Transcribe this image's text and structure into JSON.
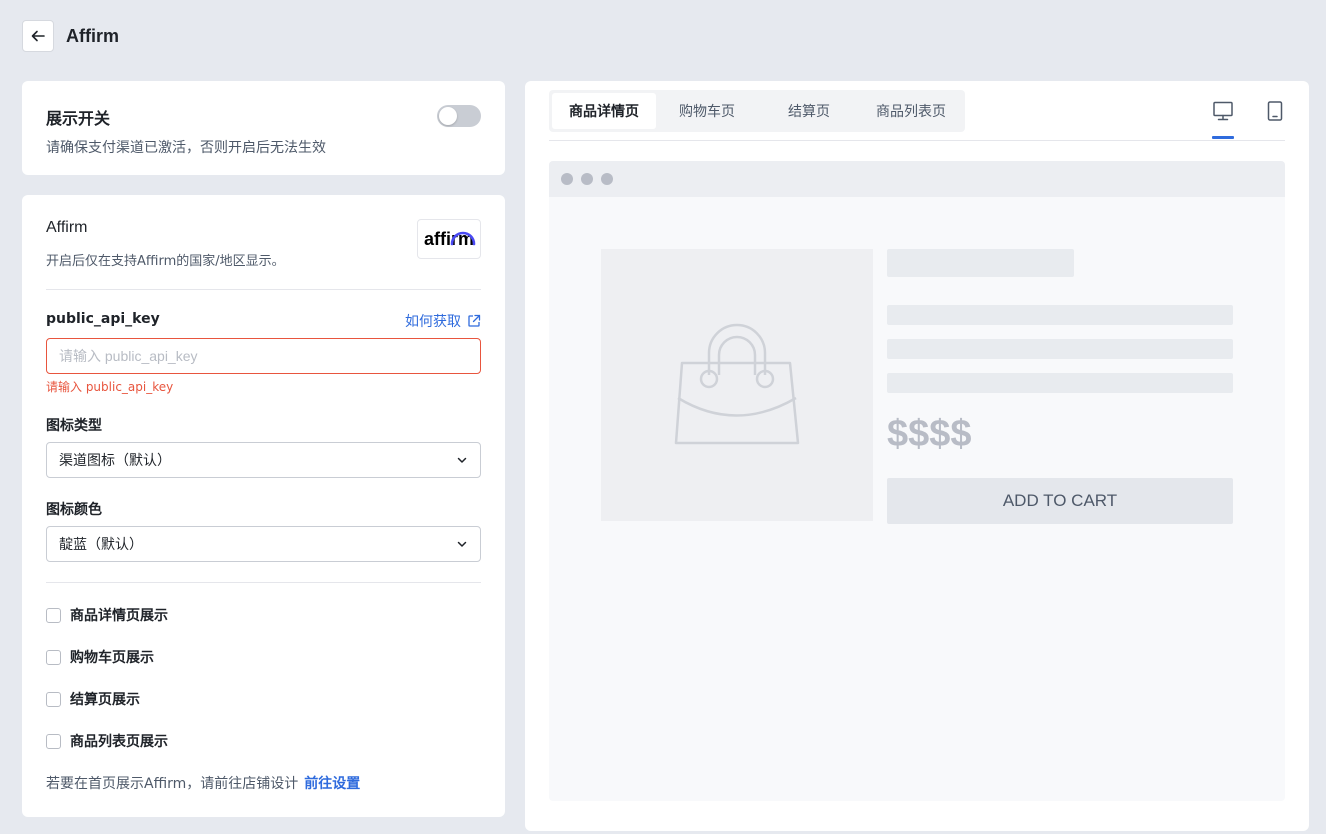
{
  "header": {
    "title": "Affirm"
  },
  "switch_card": {
    "title": "展示开关",
    "description": "请确保支付渠道已激活，否则开启后无法生效",
    "enabled": false
  },
  "form_card": {
    "name": "Affirm",
    "description": "开启后仅在支持Affirm的国家/地区显示。",
    "logo_text": "affirm",
    "api_key_label": "public_api_key",
    "how_to_get": "如何获取",
    "api_key_value": "",
    "api_key_placeholder": "请输入 public_api_key",
    "api_key_error": "请输入 public_api_key",
    "icon_type_label": "图标类型",
    "icon_type_value": "渠道图标（默认）",
    "icon_color_label": "图标颜色",
    "icon_color_value": "靛蓝（默认）",
    "checkboxes": [
      {
        "label": "商品详情页展示",
        "checked": false
      },
      {
        "label": "购物车页展示",
        "checked": false
      },
      {
        "label": "结算页展示",
        "checked": false
      },
      {
        "label": "商品列表页展示",
        "checked": false
      }
    ],
    "footer_note": "若要在首页展示Affirm，请前往店铺设计",
    "footer_link": "前往设置"
  },
  "preview": {
    "tabs": [
      {
        "label": "商品详情页",
        "active": true
      },
      {
        "label": "购物车页",
        "active": false
      },
      {
        "label": "结算页",
        "active": false
      },
      {
        "label": "商品列表页",
        "active": false
      }
    ],
    "devices": [
      "desktop-icon",
      "tablet-icon"
    ],
    "active_device": "desktop",
    "price": "$$$$",
    "add_to_cart": "ADD TO CART"
  },
  "colors": {
    "accent": "#2f6bdd",
    "error": "#e8553e",
    "affirm_arc": "#4a4af4"
  }
}
